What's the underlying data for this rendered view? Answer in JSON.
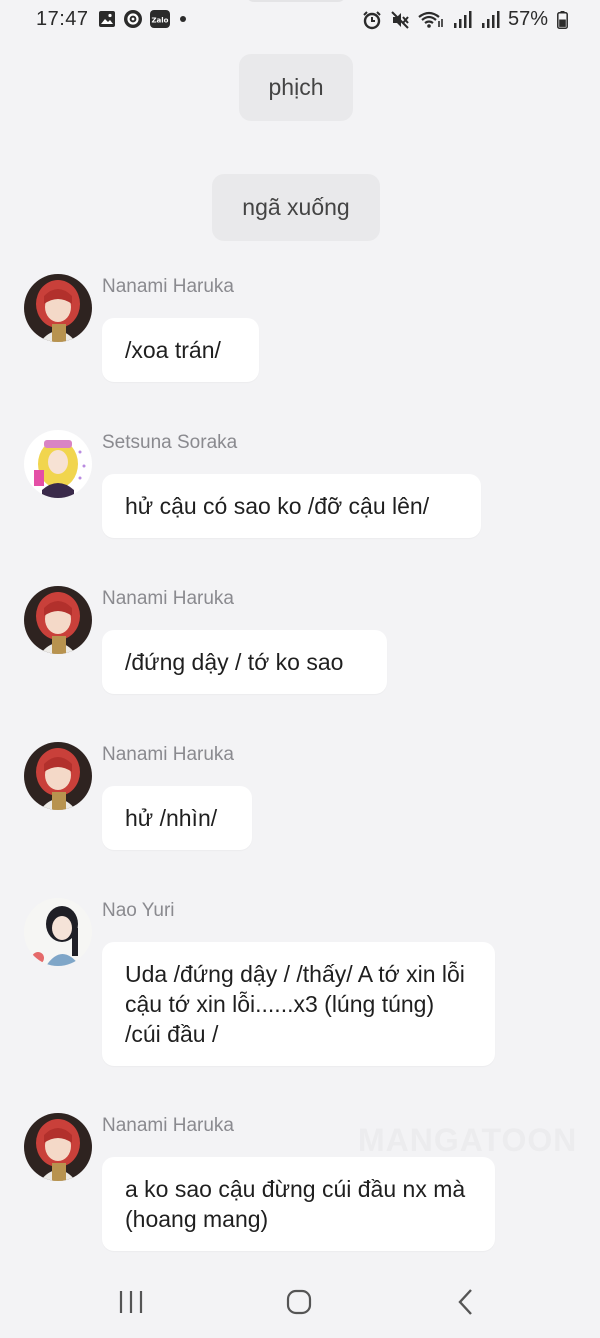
{
  "status_bar": {
    "time": "17:47",
    "left_icons": [
      "gallery-icon",
      "messenger-icon",
      "zalo-icon",
      "dot-icon"
    ],
    "zalo_text": "Zalo",
    "right_icons": [
      "alarm-icon",
      "mute-icon",
      "wifi-icon",
      "signal-icon",
      "signal-icon",
      "battery-icon"
    ],
    "battery": "57%"
  },
  "system_messages": [
    {
      "text": "phịch"
    },
    {
      "text": "ngã xuống"
    }
  ],
  "messages": [
    {
      "sender": "Nanami Haruka",
      "text": "/xoa trán/",
      "avatar": "red-hair-avatar"
    },
    {
      "sender": "Setsuna Soraka",
      "text": "hử cậu có sao ko /đỡ cậu lên/",
      "avatar": "blonde-avatar"
    },
    {
      "sender": "Nanami Haruka",
      "text": "/đứng dậy / tớ ko sao",
      "avatar": "red-hair-avatar"
    },
    {
      "sender": "Nanami Haruka",
      "text": "hử /nhìn/",
      "avatar": "red-hair-avatar"
    },
    {
      "sender": "Nao Yuri",
      "text": "Uda /đứng dậy / /thấy/ A tớ xin lỗi cậu tớ xin lỗi......x3 (lúng túng) /cúi đầu /",
      "avatar": "dark-hair-avatar"
    },
    {
      "sender": "Nanami Haruka",
      "text": "a ko sao cậu đừng cúi đầu nx mà (hoang mang)",
      "avatar": "red-hair-avatar"
    }
  ],
  "watermark": "MANGATOON",
  "nav_bar": {
    "icons": [
      "recents-icon",
      "home-icon",
      "back-icon"
    ]
  },
  "colors": {
    "background": "#f3f3f5",
    "bubble": "#ffffff",
    "system_bubble": "#e9e9eb",
    "sender": "#8a8a8f"
  }
}
